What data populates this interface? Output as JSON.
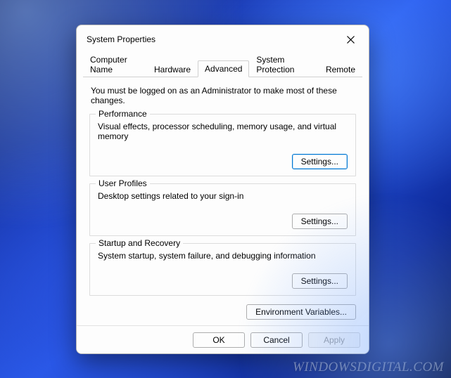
{
  "dialog": {
    "title": "System Properties"
  },
  "tabs": {
    "computer_name": "Computer Name",
    "hardware": "Hardware",
    "advanced": "Advanced",
    "system_protection": "System Protection",
    "remote": "Remote",
    "active": "advanced"
  },
  "intro": "You must be logged on as an Administrator to make most of these changes.",
  "groups": {
    "performance": {
      "legend": "Performance",
      "desc": "Visual effects, processor scheduling, memory usage, and virtual memory",
      "button": "Settings..."
    },
    "user_profiles": {
      "legend": "User Profiles",
      "desc": "Desktop settings related to your sign-in",
      "button": "Settings..."
    },
    "startup": {
      "legend": "Startup and Recovery",
      "desc": "System startup, system failure, and debugging information",
      "button": "Settings..."
    }
  },
  "env_button": "Environment Variables...",
  "footer": {
    "ok": "OK",
    "cancel": "Cancel",
    "apply": "Apply"
  },
  "watermark": "WindowsDigital.com"
}
